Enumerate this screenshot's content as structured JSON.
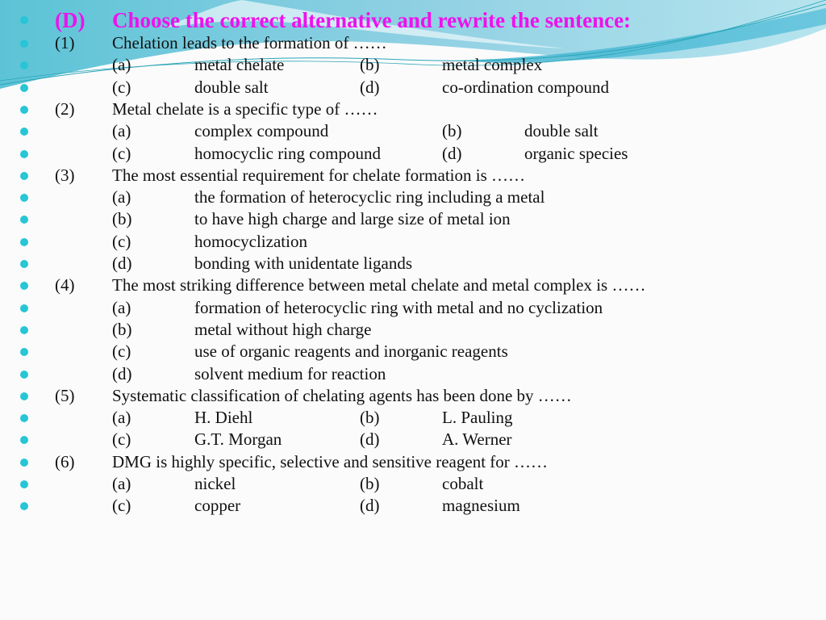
{
  "slide": {
    "heading": {
      "number": "(D)",
      "title": "Choose the correct alternative and rewrite the sentence:"
    },
    "theme": {
      "heading_color": "#ee11ee",
      "bullet_color": "#27c5d6",
      "wave_color": "#5bbfd8"
    },
    "questions": [
      {
        "number": "(1)",
        "text": "Chelation leads to the formation of ……",
        "layout": "two-column",
        "options": [
          {
            "label": "(a)",
            "text": "metal chelate"
          },
          {
            "label": "(b)",
            "text": "metal complex"
          },
          {
            "label": "(c)",
            "text": "double salt"
          },
          {
            "label": "(d)",
            "text": "co-ordination compound"
          }
        ]
      },
      {
        "number": "(2)",
        "text": "Metal chelate is a specific type of ……",
        "layout": "two-column-wide",
        "options": [
          {
            "label": "(a)",
            "text": "complex compound"
          },
          {
            "label": "(b)",
            "text": "double salt"
          },
          {
            "label": "(c)",
            "text": "homocyclic ring compound"
          },
          {
            "label": "(d)",
            "text": "organic species"
          }
        ]
      },
      {
        "number": "(3)",
        "text": "The most essential requirement for chelate formation is ……",
        "layout": "single-column",
        "options": [
          {
            "label": "(a)",
            "text": "the formation of heterocyclic ring including a metal"
          },
          {
            "label": "(b)",
            "text": "to have high charge and large size of metal ion"
          },
          {
            "label": "(c)",
            "text": "homocyclization"
          },
          {
            "label": "(d)",
            "text": "bonding with unidentate ligands"
          }
        ]
      },
      {
        "number": "(4)",
        "text": "The most striking difference between metal chelate and metal complex is ……",
        "layout": "single-column",
        "options": [
          {
            "label": "(a)",
            "text": "formation of heterocyclic ring with metal and no cyclization"
          },
          {
            "label": "(b)",
            "text": "metal without high charge"
          },
          {
            "label": "(c)",
            "text": "use of organic reagents and inorganic reagents"
          },
          {
            "label": "(d)",
            "text": "solvent medium for reaction"
          }
        ]
      },
      {
        "number": "(5)",
        "text": "Systematic classification of chelating agents has been done by ……",
        "layout": "two-column",
        "options": [
          {
            "label": "(a)",
            "text": "H. Diehl"
          },
          {
            "label": "(b)",
            "text": "L. Pauling"
          },
          {
            "label": "(c)",
            "text": "G.T. Morgan"
          },
          {
            "label": "(d)",
            "text": "A. Werner"
          }
        ]
      },
      {
        "number": "(6)",
        "text": "DMG is highly specific, selective and sensitive reagent for ……",
        "layout": "two-column",
        "options": [
          {
            "label": "(a)",
            "text": "nickel"
          },
          {
            "label": "(b)",
            "text": "cobalt"
          },
          {
            "label": "(c)",
            "text": "copper"
          },
          {
            "label": "(d)",
            "text": "magnesium"
          }
        ]
      }
    ]
  }
}
